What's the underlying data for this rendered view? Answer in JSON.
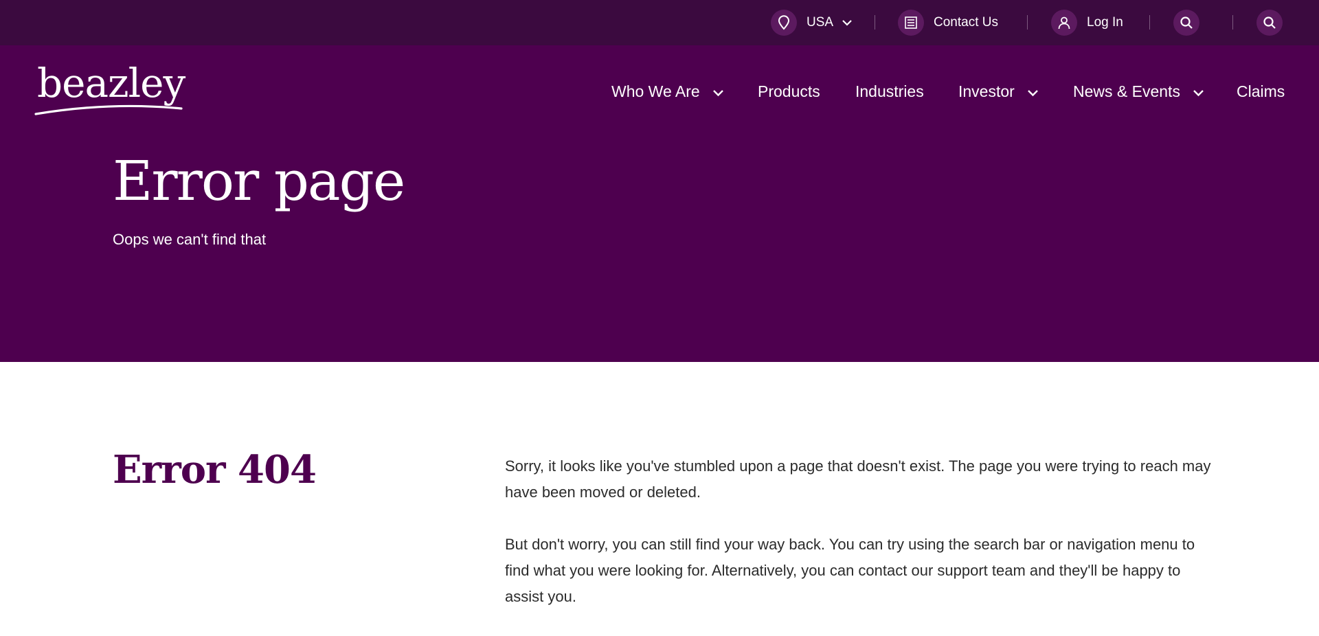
{
  "utility_bar": {
    "region_label": "USA",
    "contact_label": "Contact Us",
    "login_label": "Log In"
  },
  "brand": {
    "logo_text": "beazley"
  },
  "nav": {
    "items": [
      {
        "label": "Who We Are",
        "has_dropdown": true
      },
      {
        "label": "Products",
        "has_dropdown": false
      },
      {
        "label": "Industries",
        "has_dropdown": false
      },
      {
        "label": "Investor",
        "has_dropdown": true
      },
      {
        "label": "News & Events",
        "has_dropdown": true
      },
      {
        "label": "Claims",
        "has_dropdown": false
      }
    ]
  },
  "hero": {
    "title": "Error page",
    "subtitle": "Oops we can't find that"
  },
  "content": {
    "heading": "Error 404",
    "paragraphs": [
      "Sorry, it looks like you've stumbled upon a page that doesn't exist. The page you were trying to reach may have been moved or deleted.",
      "But don't worry, you can still find your way back. You can try using the search bar or navigation menu to find what you were looking for. Alternatively, you can contact our support team and they'll be happy to assist you."
    ]
  },
  "colors": {
    "utility_bar_bg": "#3b0a3f",
    "brand_purple": "#4e004f",
    "icon_circle": "#5c1a5f",
    "text_white": "#ffffff",
    "body_text": "#2b2b2b"
  },
  "icons": {
    "location": "location-pin-icon",
    "region_chevron": "chevron-down-icon",
    "contact": "document-list-icon",
    "login": "user-icon",
    "search": "search-icon"
  }
}
